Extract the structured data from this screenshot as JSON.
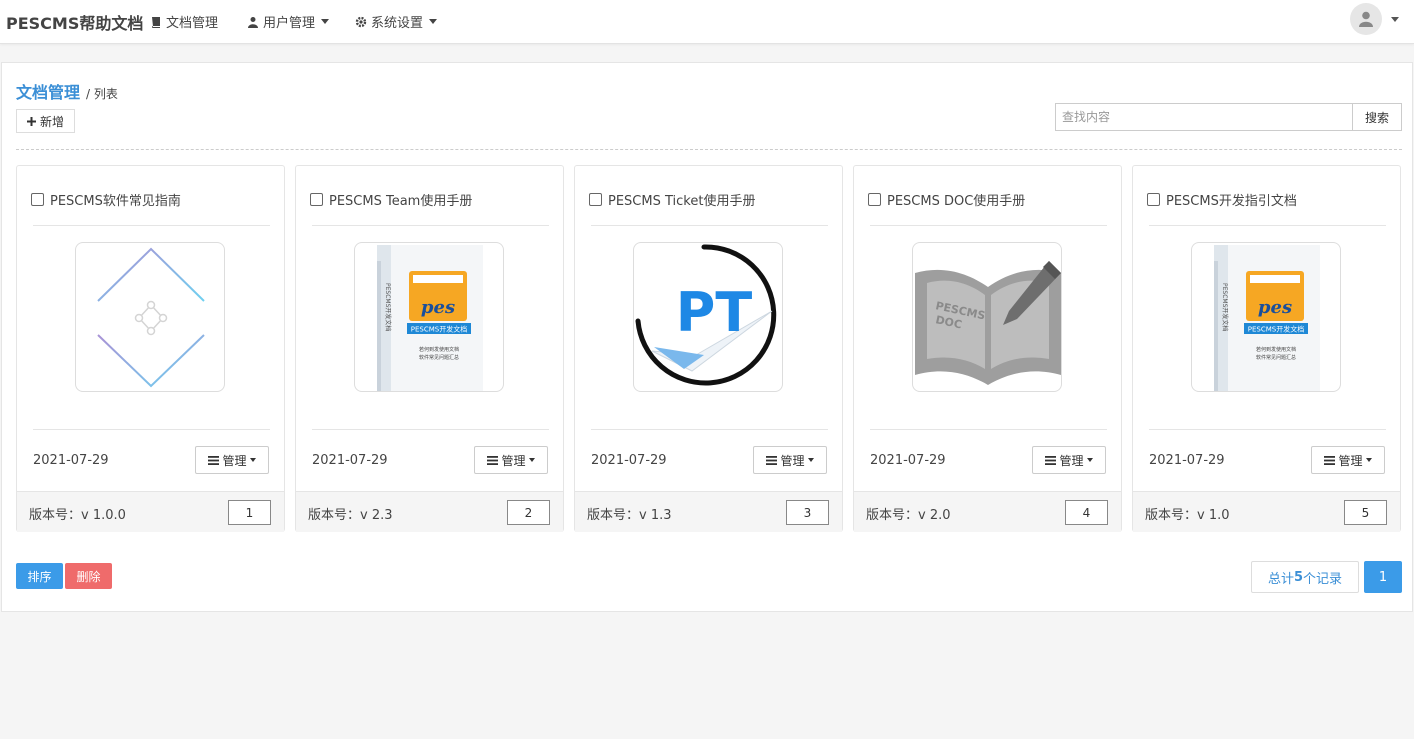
{
  "navbar": {
    "brand": "PESCMS帮助文档",
    "items": [
      {
        "label": "文档管理",
        "icon": "book-icon",
        "dropdown": false
      },
      {
        "label": "用户管理",
        "icon": "users-icon",
        "dropdown": true
      },
      {
        "label": "系统设置",
        "icon": "gear-icon",
        "dropdown": true
      }
    ],
    "avatar_icon": "user-icon"
  },
  "page": {
    "breadcrumb_main": "文档管理",
    "breadcrumb_sub": "/ 列表",
    "add_label": "新增",
    "search_placeholder": "查找内容",
    "search_label": "搜索"
  },
  "cards": [
    {
      "title": "PESCMS软件常见指南",
      "date": "2021-07-29",
      "manage_label": "管理",
      "version": "版本号：v 1.0.0",
      "sort": "1",
      "thumb": "diamond-logo"
    },
    {
      "title": "PESCMS Team使用手册",
      "date": "2021-07-29",
      "manage_label": "管理",
      "version": "版本号：v 2.3",
      "sort": "2",
      "thumb": "pes-box"
    },
    {
      "title": "PESCMS Ticket使用手册",
      "date": "2021-07-29",
      "manage_label": "管理",
      "version": "版本号：v 1.3",
      "sort": "3",
      "thumb": "pt-logo"
    },
    {
      "title": "PESCMS DOC使用手册",
      "date": "2021-07-29",
      "manage_label": "管理",
      "version": "版本号：v 2.0",
      "sort": "4",
      "thumb": "doc-book"
    },
    {
      "title": "PESCMS开发指引文档",
      "date": "2021-07-29",
      "manage_label": "管理",
      "version": "版本号：v 1.0",
      "sort": "5",
      "thumb": "pes-box"
    }
  ],
  "box_art": {
    "logo_text": "pes",
    "banner_text": "PESCMS开发文档",
    "spine_text": "PESCMS开发文档",
    "line1": "若何到发使用文档",
    "line2": "软件常见问题汇总"
  },
  "pt_text": "PT",
  "doc_text_1": "PESCMS",
  "doc_text_2": "DOC",
  "footer": {
    "sort_label": "排序",
    "delete_label": "删除",
    "total_prefix": "总计",
    "total_count": "5",
    "total_suffix": "个记录",
    "page": "1"
  },
  "colors": {
    "accent": "#3b9be8",
    "danger": "#ef6b6b",
    "link": "#3b8fd6"
  }
}
